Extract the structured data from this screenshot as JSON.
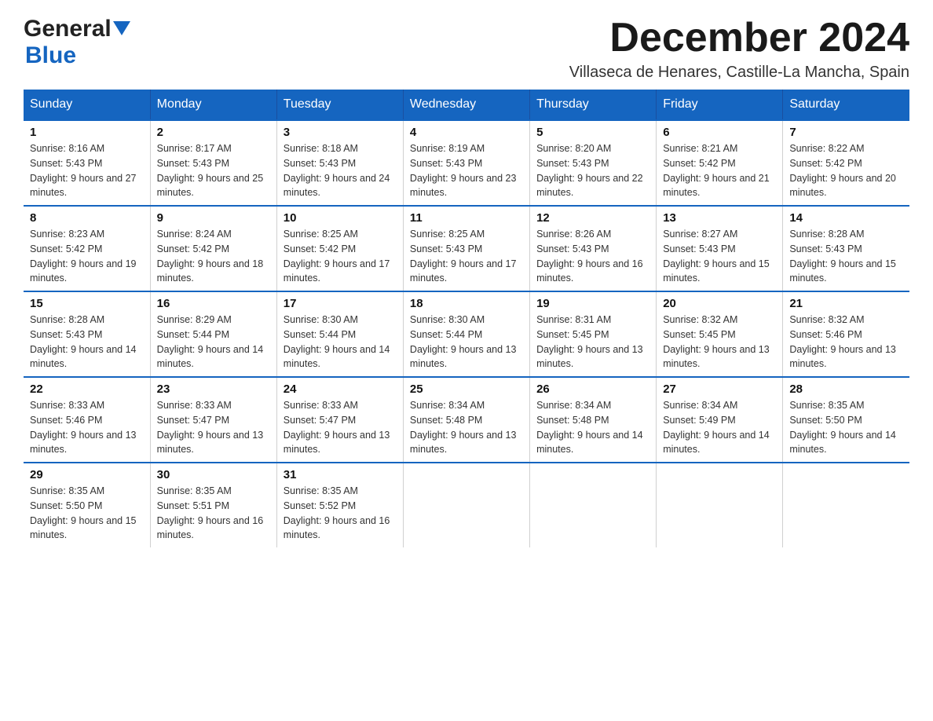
{
  "header": {
    "logo_line1": "General",
    "logo_line2": "Blue",
    "month_title": "December 2024",
    "location": "Villaseca de Henares, Castille-La Mancha, Spain"
  },
  "columns": [
    "Sunday",
    "Monday",
    "Tuesday",
    "Wednesday",
    "Thursday",
    "Friday",
    "Saturday"
  ],
  "weeks": [
    [
      {
        "day": "1",
        "sunrise": "8:16 AM",
        "sunset": "5:43 PM",
        "daylight": "9 hours and 27 minutes."
      },
      {
        "day": "2",
        "sunrise": "8:17 AM",
        "sunset": "5:43 PM",
        "daylight": "9 hours and 25 minutes."
      },
      {
        "day": "3",
        "sunrise": "8:18 AM",
        "sunset": "5:43 PM",
        "daylight": "9 hours and 24 minutes."
      },
      {
        "day": "4",
        "sunrise": "8:19 AM",
        "sunset": "5:43 PM",
        "daylight": "9 hours and 23 minutes."
      },
      {
        "day": "5",
        "sunrise": "8:20 AM",
        "sunset": "5:43 PM",
        "daylight": "9 hours and 22 minutes."
      },
      {
        "day": "6",
        "sunrise": "8:21 AM",
        "sunset": "5:42 PM",
        "daylight": "9 hours and 21 minutes."
      },
      {
        "day": "7",
        "sunrise": "8:22 AM",
        "sunset": "5:42 PM",
        "daylight": "9 hours and 20 minutes."
      }
    ],
    [
      {
        "day": "8",
        "sunrise": "8:23 AM",
        "sunset": "5:42 PM",
        "daylight": "9 hours and 19 minutes."
      },
      {
        "day": "9",
        "sunrise": "8:24 AM",
        "sunset": "5:42 PM",
        "daylight": "9 hours and 18 minutes."
      },
      {
        "day": "10",
        "sunrise": "8:25 AM",
        "sunset": "5:42 PM",
        "daylight": "9 hours and 17 minutes."
      },
      {
        "day": "11",
        "sunrise": "8:25 AM",
        "sunset": "5:43 PM",
        "daylight": "9 hours and 17 minutes."
      },
      {
        "day": "12",
        "sunrise": "8:26 AM",
        "sunset": "5:43 PM",
        "daylight": "9 hours and 16 minutes."
      },
      {
        "day": "13",
        "sunrise": "8:27 AM",
        "sunset": "5:43 PM",
        "daylight": "9 hours and 15 minutes."
      },
      {
        "day": "14",
        "sunrise": "8:28 AM",
        "sunset": "5:43 PM",
        "daylight": "9 hours and 15 minutes."
      }
    ],
    [
      {
        "day": "15",
        "sunrise": "8:28 AM",
        "sunset": "5:43 PM",
        "daylight": "9 hours and 14 minutes."
      },
      {
        "day": "16",
        "sunrise": "8:29 AM",
        "sunset": "5:44 PM",
        "daylight": "9 hours and 14 minutes."
      },
      {
        "day": "17",
        "sunrise": "8:30 AM",
        "sunset": "5:44 PM",
        "daylight": "9 hours and 14 minutes."
      },
      {
        "day": "18",
        "sunrise": "8:30 AM",
        "sunset": "5:44 PM",
        "daylight": "9 hours and 13 minutes."
      },
      {
        "day": "19",
        "sunrise": "8:31 AM",
        "sunset": "5:45 PM",
        "daylight": "9 hours and 13 minutes."
      },
      {
        "day": "20",
        "sunrise": "8:32 AM",
        "sunset": "5:45 PM",
        "daylight": "9 hours and 13 minutes."
      },
      {
        "day": "21",
        "sunrise": "8:32 AM",
        "sunset": "5:46 PM",
        "daylight": "9 hours and 13 minutes."
      }
    ],
    [
      {
        "day": "22",
        "sunrise": "8:33 AM",
        "sunset": "5:46 PM",
        "daylight": "9 hours and 13 minutes."
      },
      {
        "day": "23",
        "sunrise": "8:33 AM",
        "sunset": "5:47 PM",
        "daylight": "9 hours and 13 minutes."
      },
      {
        "day": "24",
        "sunrise": "8:33 AM",
        "sunset": "5:47 PM",
        "daylight": "9 hours and 13 minutes."
      },
      {
        "day": "25",
        "sunrise": "8:34 AM",
        "sunset": "5:48 PM",
        "daylight": "9 hours and 13 minutes."
      },
      {
        "day": "26",
        "sunrise": "8:34 AM",
        "sunset": "5:48 PM",
        "daylight": "9 hours and 14 minutes."
      },
      {
        "day": "27",
        "sunrise": "8:34 AM",
        "sunset": "5:49 PM",
        "daylight": "9 hours and 14 minutes."
      },
      {
        "day": "28",
        "sunrise": "8:35 AM",
        "sunset": "5:50 PM",
        "daylight": "9 hours and 14 minutes."
      }
    ],
    [
      {
        "day": "29",
        "sunrise": "8:35 AM",
        "sunset": "5:50 PM",
        "daylight": "9 hours and 15 minutes."
      },
      {
        "day": "30",
        "sunrise": "8:35 AM",
        "sunset": "5:51 PM",
        "daylight": "9 hours and 16 minutes."
      },
      {
        "day": "31",
        "sunrise": "8:35 AM",
        "sunset": "5:52 PM",
        "daylight": "9 hours and 16 minutes."
      },
      null,
      null,
      null,
      null
    ]
  ]
}
